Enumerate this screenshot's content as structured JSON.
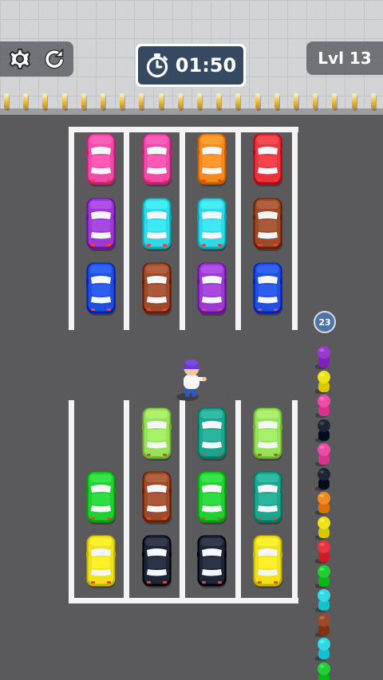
{
  "hud": {
    "timer": "01:50",
    "level": "Lvl 13",
    "queue_count": "23",
    "settings_icon": "gear-icon",
    "restart_icon": "restart-icon",
    "timer_icon": "stopwatch-icon"
  },
  "upper_lot": {
    "rows": [
      [
        "pink",
        "pink",
        "orange",
        "red"
      ],
      [
        "purple",
        "cyan",
        "cyan",
        "brown"
      ],
      [
        "blue",
        "brown",
        "purple",
        "blue"
      ]
    ]
  },
  "lower_lot": {
    "rows": [
      [
        "empty",
        "lime",
        "teal",
        "lime"
      ],
      [
        "green",
        "brown",
        "green",
        "teal"
      ],
      [
        "yellow",
        "navy",
        "navy",
        "yellow"
      ]
    ]
  },
  "queue": [
    "purple",
    "yellow",
    "pink",
    "navy",
    "pink",
    "navy",
    "orange",
    "yellow",
    "red",
    "green",
    "cyan",
    "brown",
    "cyan",
    "green"
  ],
  "colors": {
    "pink": "#f04ba6",
    "orange": "#f48a1e",
    "red": "#e8343d",
    "purple": "#9a3ad2",
    "cyan": "#2fd9e6",
    "brown": "#9b4a2a",
    "blue": "#1e4fe0",
    "lime": "#98e15a",
    "teal": "#1ca58f",
    "green": "#22cf33",
    "yellow": "#f0e11a",
    "navy": "#1d2436",
    "asphalt": "#5a5a5c",
    "lines": "#f4f4f4",
    "timer_bg": "#354960"
  }
}
